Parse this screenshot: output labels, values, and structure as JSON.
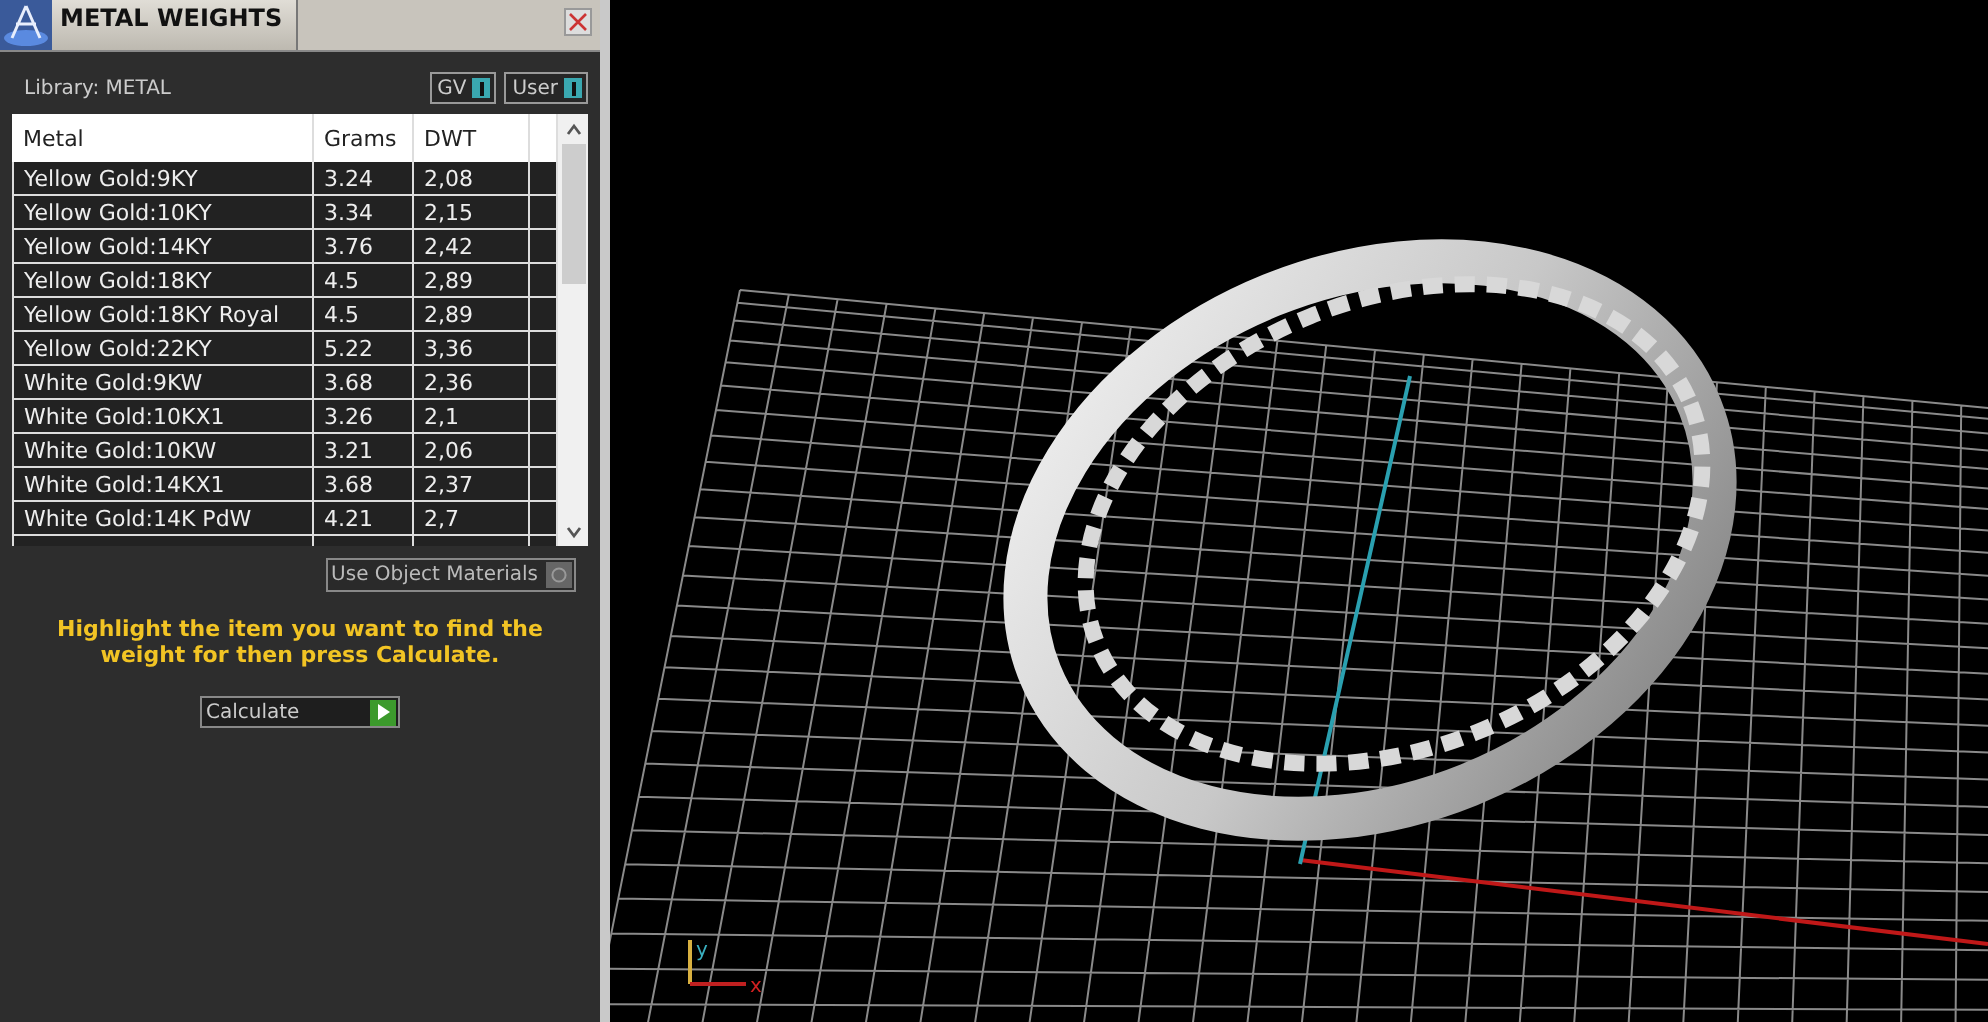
{
  "panel": {
    "title": "METAL WEIGHTS",
    "library_label": "Library: METAL",
    "toggles": [
      {
        "label": "GV",
        "on": true
      },
      {
        "label": "User",
        "on": true
      }
    ],
    "table": {
      "columns": [
        "Metal",
        "Grams",
        "DWT"
      ],
      "rows": [
        [
          "Yellow Gold:9KY",
          "3.24",
          "2,08"
        ],
        [
          "Yellow Gold:10KY",
          "3.34",
          "2,15"
        ],
        [
          "Yellow Gold:14KY",
          "3.76",
          "2,42"
        ],
        [
          "Yellow Gold:18KY",
          "4.5",
          "2,89"
        ],
        [
          "Yellow Gold:18KY Royal",
          "4.5",
          "2,89"
        ],
        [
          "Yellow Gold:22KY",
          "5.22",
          "3,36"
        ],
        [
          "White Gold:9KW",
          "3.68",
          "2,36"
        ],
        [
          "White Gold:10KX1",
          "3.26",
          "2,1"
        ],
        [
          "White Gold:10KW",
          "3.21",
          "2,06"
        ],
        [
          "White Gold:14KX1",
          "3.68",
          "2,37"
        ],
        [
          "White Gold:14K PdW",
          "4.21",
          "2,7"
        ]
      ]
    },
    "option": {
      "label": "Use Object Materials",
      "checked": false
    },
    "instruction": "Highlight the item you want to find the weight for then press Calculate.",
    "calculate_button": "Calculate"
  },
  "viewport": {
    "axis_labels": [
      "y",
      "x"
    ]
  }
}
